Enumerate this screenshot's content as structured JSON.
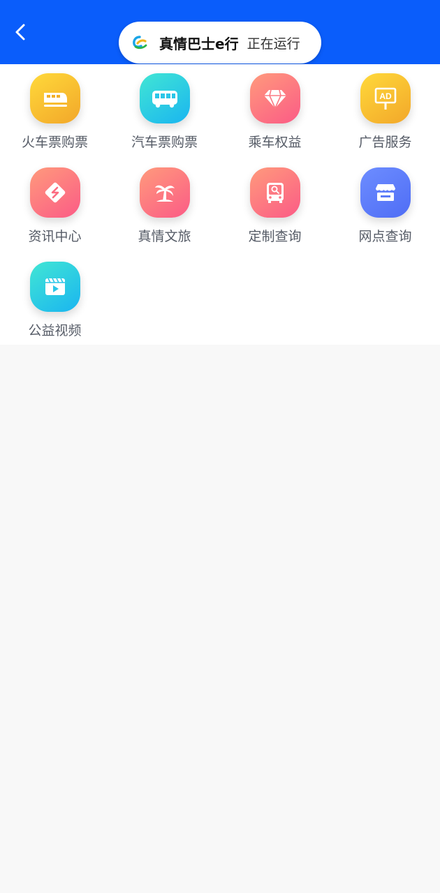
{
  "header": {
    "running_app": "真情巴士e行",
    "running_status": "正在运行"
  },
  "colors": {
    "header_bg": "#0a5dfb",
    "page_bg": "#f8f8f8",
    "label_text": "#555b66"
  },
  "grid": {
    "items": [
      {
        "label": "火车票购票",
        "icon": "train-icon"
      },
      {
        "label": "汽车票购票",
        "icon": "bus-icon"
      },
      {
        "label": "乘车权益",
        "icon": "diamond-icon"
      },
      {
        "label": "广告服务",
        "icon": "ad-board-icon"
      },
      {
        "label": "资讯中心",
        "icon": "news-icon"
      },
      {
        "label": "真情文旅",
        "icon": "palm-tree-icon"
      },
      {
        "label": "定制查询",
        "icon": "custom-bus-search-icon"
      },
      {
        "label": "网点查询",
        "icon": "store-icon"
      },
      {
        "label": "公益视频",
        "icon": "video-icon"
      }
    ]
  }
}
